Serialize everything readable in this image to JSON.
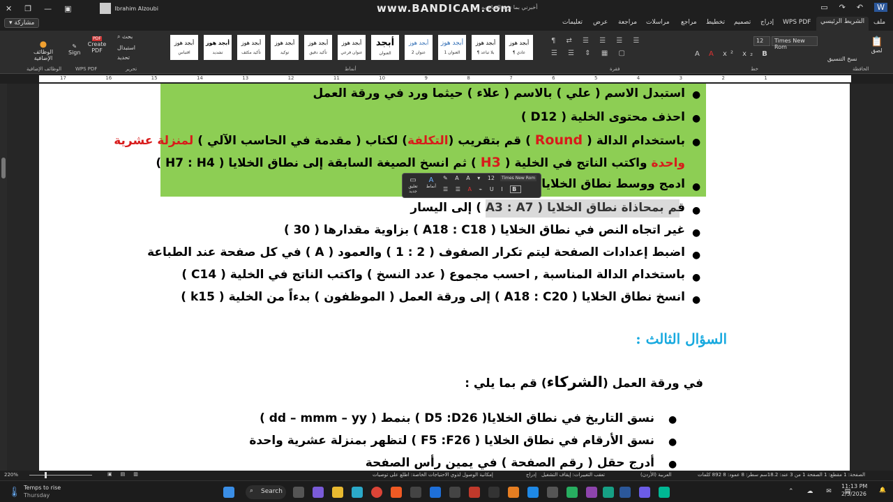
{
  "watermark": "www.BANDICAM.com",
  "titlebar": {
    "user": "Ibrahim Alzoubi",
    "search": "أخبرني بما تريد القيام به"
  },
  "tabs": [
    "ملف",
    "الشريط الرئيسي",
    "WPS PDF",
    "إدراج",
    "تصميم",
    "تخطيط",
    "مراجع",
    "مراسلات",
    "مراجعة",
    "عرض",
    "تعليمات"
  ],
  "share": "مشاركة",
  "ribbon": {
    "font_name": "Times New Rom",
    "font_size": "12",
    "styles": [
      {
        "top": "أبجد هوز",
        "sub": "¶ عادي"
      },
      {
        "top": "أبجد هوز",
        "sub": "¶ بلا تباعد"
      },
      {
        "top": "أبجد هوز",
        "sub": "العنوان 1"
      },
      {
        "top": "أبجد هوز",
        "sub": "عنوان 2"
      },
      {
        "top": "أبجد",
        "sub": "العنوان"
      },
      {
        "top": "أبجد هوز",
        "sub": "عنوان فرعي"
      },
      {
        "top": "أبجد هوز",
        "sub": "تأكيد دقيق"
      },
      {
        "top": "أبجد هوز",
        "sub": "توكيد"
      },
      {
        "top": "أبجد هوز",
        "sub": "تأكيد مكثف"
      },
      {
        "top": "أبجد هوز",
        "sub": "تشديد"
      },
      {
        "top": "أبجد هوز",
        "sub": "اقتباس"
      }
    ],
    "groups": {
      "clipboard": "الحافظة",
      "font": "خط",
      "paragraph": "فقرة",
      "styles": "أنماط",
      "editing": "تحرير",
      "pdf": "WPS PDF",
      "addins": "الوظائف الإضافية"
    },
    "edit_items": [
      "بحث",
      "استبدال",
      "تحديد"
    ],
    "paste": "لصق",
    "format_painter": "نسخ التنسيق",
    "sign": "Sign",
    "create_pdf": "Create PDF",
    "addins": "الوظائف الإضافية"
  },
  "ruler": [
    "17",
    "16",
    "15",
    "14",
    "13",
    "12",
    "11",
    "10",
    "9",
    "8",
    "7",
    "6",
    "5",
    "4",
    "3",
    "2",
    "1"
  ],
  "doc": {
    "l1": "استبدل الاسم ( علي ) بالاسم ( علاء ) حيثما ورد في ورقة العمل",
    "l2": "احذف محتوى الخلية ( D12 )",
    "l3a": "باستخدام الدالة (",
    "l3b": "Round",
    "l3c": ") قم بتقريب (",
    "l3d": "التكلفة",
    "l3e": ") لكتاب ( مقدمة في الحاسب الآلي )",
    "l3f": "لمنزلة عشرية",
    "l4a": "واحدة",
    "l4b": "واكتب الناتج في الخلية (",
    "l4c": "H3",
    "l4d": ") ثم انسخ الصيغة السابقة إلى نطاق الخلايا ( H7 : H4 )",
    "l5": "ادمج ووسط نطاق الخلايا",
    "l6": "قم بمحاذاة نطاق الخلايا ( A3 : A7 ) إلى اليسار",
    "l7": "غير اتجاه النص في نطاق الخلايا ( A18 : C18 ) بزاوية مقدارها ( 30 )",
    "l8": "اضبط إعدادات الصفحة ليتم تكرار الصفوف ( 2 : 1 ) والعمود ( A ) في كل صفحة عند الطباعة",
    "l9": "باستخدام الدالة المناسبة , احسب مجموع ( عدد النسخ ) واكتب الناتج في الخلية ( C14 )",
    "l10": "انسخ نطاق الخلايا ( A18 : C20 ) إلى ورقة العمل ( الموظفون ) بدءاً من الخلية ( k15 )",
    "heading": "السؤال الثالث :",
    "q3a": "في ورقة العمل (",
    "q3b": "الشركاء",
    "q3c": ") قم بما يلي :",
    "s1": "نسق التاريخ في نطاق الخلايا( D5 :D26 ) بنمط ( dd – mmm – yy )",
    "s2": "نسق الأرقام في نطاق الخلايا ( F5 :F26 ) لتظهر بمنزلة عشرية واحدة",
    "s3": "أدرج حقل ( رقم الصفحة ) في يمين رأس الصفحة"
  },
  "minitoolbar": {
    "new_comment": "تعليق جديد",
    "styles": "أنماط",
    "font": "Times New Rom",
    "size": "12"
  },
  "status": {
    "page": "الصفحة: 1   مقطع: 1   الصفحة 1 من 3   عند: 18.2سم   سطر: 8   عمود: 8   892 كلمات",
    "lang": "العربية (الأردن)",
    "track": "تعقب التغييرات: إيقاف التشغيل",
    "insert": "إدراج",
    "accessibility": "إمكانية الوصول لذوي الاحتياجات الخاصة: اطلع على توصيات",
    "zoom": "220%"
  },
  "taskbar": {
    "weather_title": "Temps to rise",
    "weather_day": "Thursday",
    "search": "Search",
    "time": "11:13 PM",
    "date": "2/3/2026",
    "colors": {
      "accent": "#8dce54",
      "red": "#d81b1b",
      "heading": "#17a9df"
    }
  }
}
